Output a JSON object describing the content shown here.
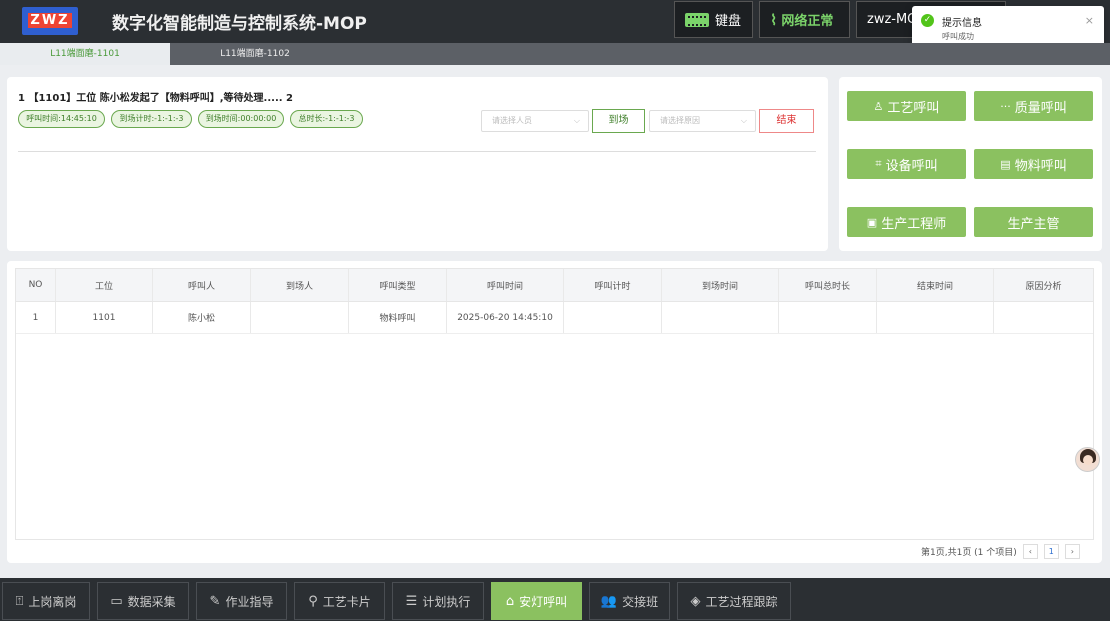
{
  "header": {
    "logo_text": "ZWZ",
    "title": "数字化智能制造与控制系统-MOP",
    "keyboard_label": "键盘",
    "network_label": "网络正常",
    "user_label": "zwz-MO"
  },
  "toast": {
    "title": "提示信息",
    "message": "呼叫成功",
    "close": "×"
  },
  "tabs": [
    {
      "label": "L11端面磨-1101",
      "active": true
    },
    {
      "label": "L11端面磨-1102",
      "active": false
    }
  ],
  "call": {
    "headline": "1 【1101】工位 陈小松发起了【物料呼叫】,等待处理..... 2",
    "pills": [
      "呼叫时间:14:45:10",
      "到场计时:-1:-1:-3",
      "到场时间:00:00:00",
      "总时长:-1:-1:-3"
    ],
    "person_placeholder": "请选择人员",
    "arrive_button": "到场",
    "reason_placeholder": "请选择原因",
    "end_button": "结束"
  },
  "call_buttons": {
    "craft": "工艺呼叫",
    "quality": "质量呼叫",
    "equipment": "设备呼叫",
    "material": "物料呼叫",
    "engineer": "生产工程师",
    "supervisor": "生产主管"
  },
  "table": {
    "columns": [
      "NO",
      "工位",
      "呼叫人",
      "到场人",
      "呼叫类型",
      "呼叫时间",
      "呼叫计时",
      "到场时间",
      "呼叫总时长",
      "结束时间",
      "原因分析"
    ],
    "rows": [
      [
        "1",
        "1101",
        "陈小松",
        "",
        "物料呼叫",
        "2025-06-20 14:45:10",
        "",
        "",
        "",
        "",
        ""
      ]
    ]
  },
  "pager": {
    "summary": "第1页,共1页 (1 个项目)",
    "prev": "‹",
    "current": "1",
    "next": "›"
  },
  "bottom_nav": [
    {
      "label": "上岗离岗",
      "icon": "clipboard-icon"
    },
    {
      "label": "数据采集",
      "icon": "monitor-icon"
    },
    {
      "label": "作业指导",
      "icon": "edit-icon"
    },
    {
      "label": "工艺卡片",
      "icon": "flow-icon"
    },
    {
      "label": "计划执行",
      "icon": "list-icon"
    },
    {
      "label": "安灯呼叫",
      "icon": "lamp-icon",
      "active": true
    },
    {
      "label": "交接班",
      "icon": "users-icon"
    },
    {
      "label": "工艺过程跟踪",
      "icon": "layers-icon"
    }
  ],
  "colors": {
    "accent_green": "#8bc160",
    "header_dark": "#2b2f33",
    "end_red": "#d33333"
  }
}
